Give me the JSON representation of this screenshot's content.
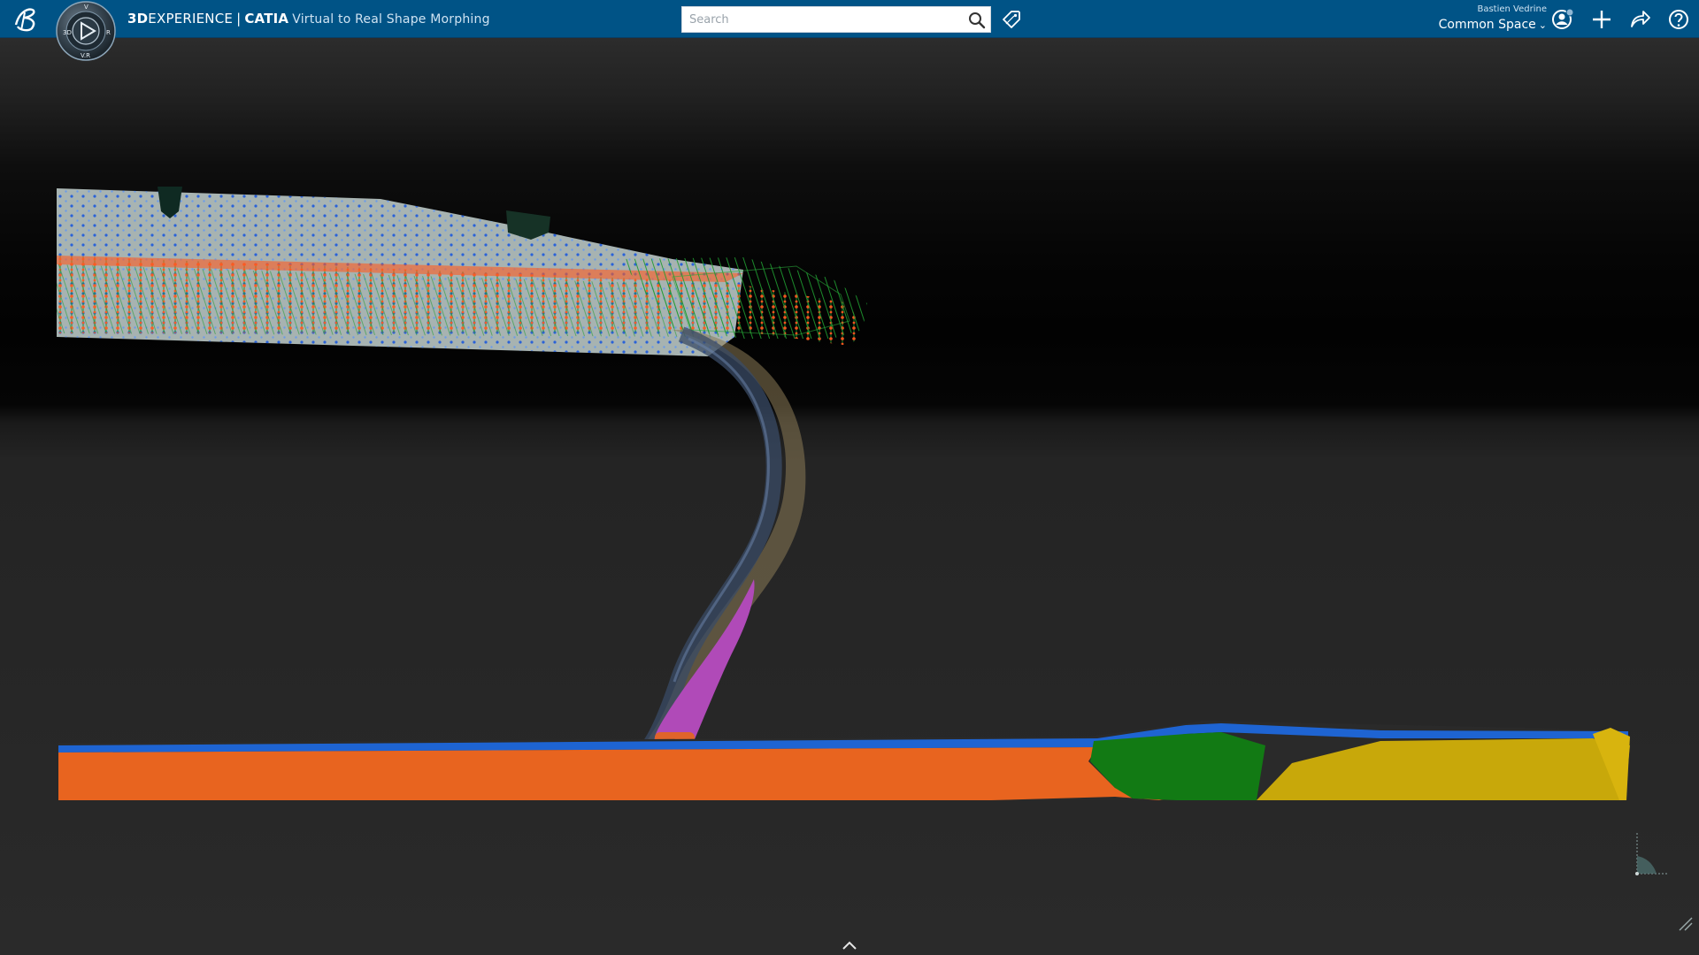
{
  "topbar": {
    "brand_3d": "3D",
    "brand_experience": "EXPERIENCE",
    "brand_separator": "|",
    "brand_app": "CATIA",
    "brand_title": "Virtual to Real Shape Morphing",
    "search_placeholder": "Search",
    "user_name": "Bastien Vedrine",
    "space_name": "Common Space",
    "icons": [
      "ds-logo-icon",
      "compass-icon",
      "search-icon",
      "tag-icon",
      "user-icon",
      "add-icon",
      "share-icon",
      "help-icon"
    ]
  },
  "compass": {
    "letters": [
      "3D",
      "V",
      "R",
      "V.R"
    ]
  },
  "colors": {
    "topbar": "#005386",
    "viewport_top": "#2a2a2a",
    "viewport_band": "#000000",
    "shell_points_orange": "#ff5a1f",
    "shell_points_blue": "#1e5fd6",
    "mesh_green": "#1e9a2e",
    "blade_magenta": "#b04ab8",
    "plate_blue": "#1e64d2",
    "plate_orange": "#e8641f",
    "plate_green": "#127a14",
    "plate_yellow": "#c8a80a"
  }
}
